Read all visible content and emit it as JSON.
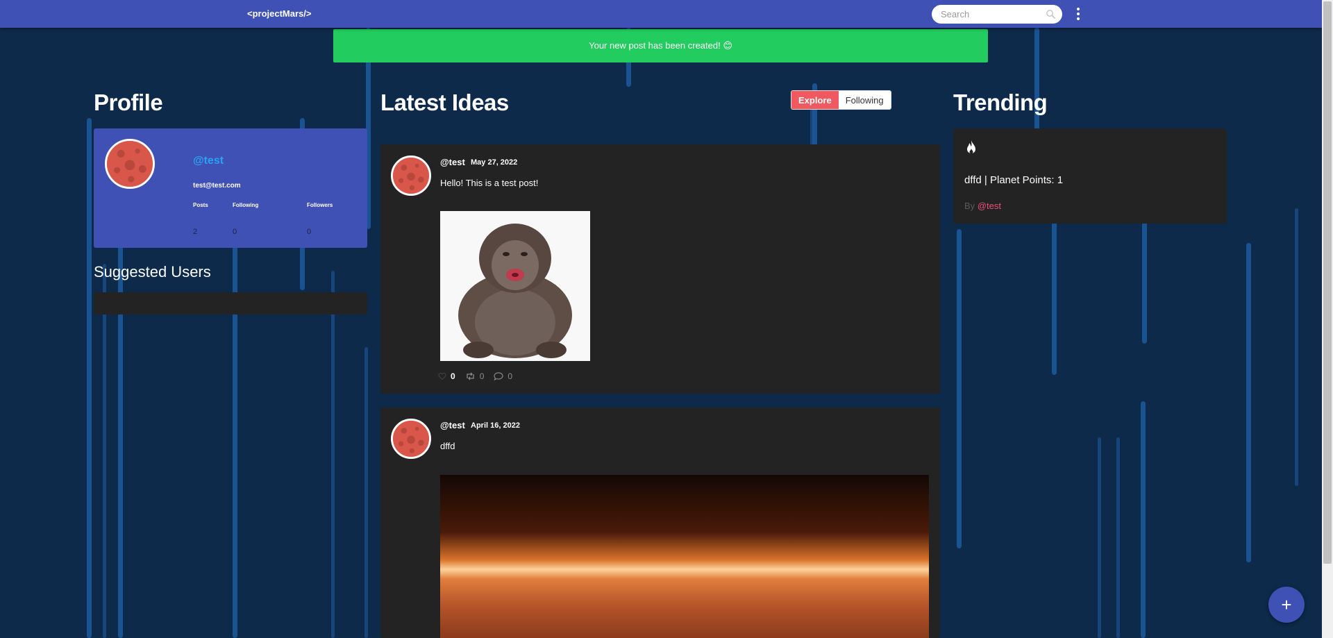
{
  "navbar": {
    "brand": "<projectMars/>",
    "search_placeholder": "Search"
  },
  "toast": {
    "message": "Your new post has been created! 😊"
  },
  "profile": {
    "heading": "Profile",
    "handle": "@test",
    "email": "test@test.com",
    "stats": [
      {
        "label": "Posts",
        "value": "2"
      },
      {
        "label": "Following",
        "value": "0"
      },
      {
        "label": "Followers",
        "value": "0"
      }
    ]
  },
  "suggested": {
    "heading": "Suggested Users"
  },
  "feed": {
    "heading": "Latest Ideas",
    "tabs": {
      "explore": "Explore",
      "following": "Following"
    },
    "posts": [
      {
        "user": "@test",
        "date": "May 27, 2022",
        "text": "Hello! This is a test post!",
        "likes": "0",
        "reposts": "0",
        "comments": "0"
      },
      {
        "user": "@test",
        "date": "April 16, 2022",
        "text": "dffd"
      }
    ]
  },
  "trending": {
    "heading": "Trending",
    "item_title": "dffd | Planet Points: 1",
    "by_label": "By",
    "by_handle": "@test"
  },
  "fab": {
    "label": "+"
  },
  "colors": {
    "navbar": "#3f51b5",
    "toast": "#22cc5e",
    "background": "#0d2a4a",
    "card": "#232323",
    "explore_tab": "#f0595f",
    "handle_pink": "#ec4f79",
    "handle_blue": "#29a3f0"
  }
}
